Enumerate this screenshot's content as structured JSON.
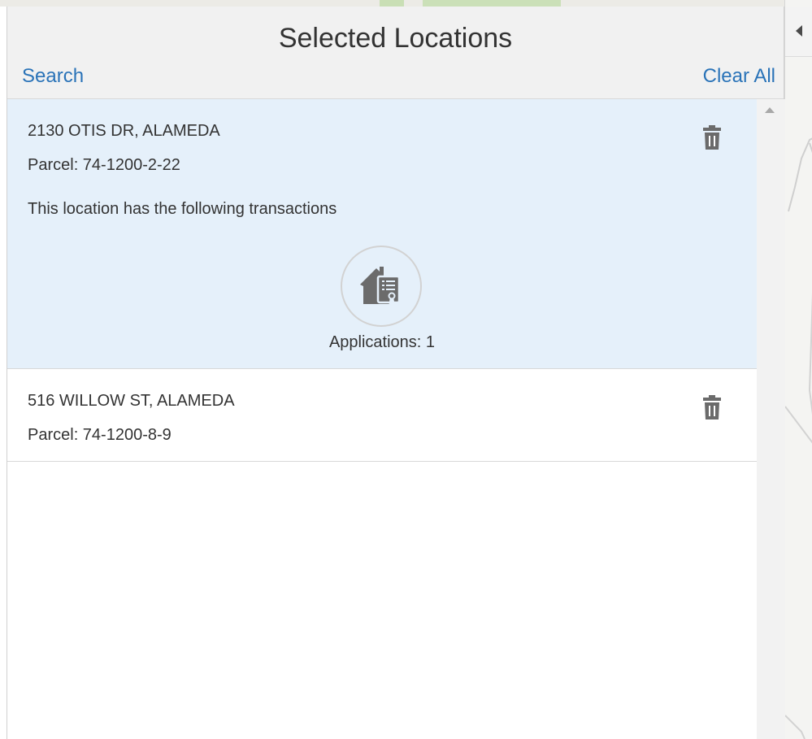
{
  "panel": {
    "title": "Selected Locations",
    "search_link": "Search",
    "clear_all_link": "Clear All"
  },
  "locations": [
    {
      "address": "2130 OTIS DR, ALAMEDA",
      "parcel": "Parcel: 74-1200-2-22",
      "transactions_note": "This location has the following transactions",
      "applications_label": "Applications: 1",
      "selected": true
    },
    {
      "address": "516 WILLOW ST, ALAMEDA",
      "parcel": "Parcel: 74-1200-8-9",
      "selected": false
    }
  ],
  "icons": {
    "delete": "trash-icon",
    "application": "house-permit-icon",
    "collapse": "caret-left-icon",
    "scroll_up": "scroll-up-arrow-icon"
  },
  "colors": {
    "link": "#2a73b8",
    "selected_row": "#e5f0fa",
    "header_bg": "#f1f1f1",
    "icon_gray": "#6b6b6b"
  }
}
